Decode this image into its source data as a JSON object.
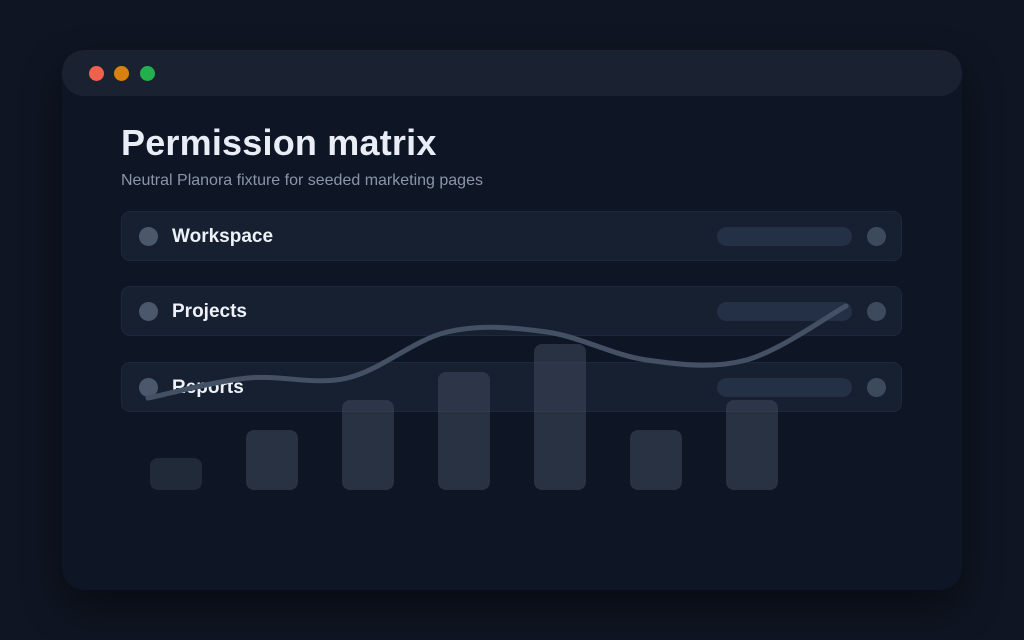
{
  "window": {
    "controls": [
      {
        "name": "close",
        "color": "#f0604d"
      },
      {
        "name": "minimize",
        "color": "#d9800f"
      },
      {
        "name": "maximize",
        "color": "#21b04b"
      }
    ]
  },
  "page": {
    "title": "Permission matrix",
    "subtitle": "Neutral Planora fixture for seeded marketing pages"
  },
  "rows": [
    {
      "label": "Workspace"
    },
    {
      "label": "Projects"
    },
    {
      "label": "Reports"
    }
  ],
  "chart_data": {
    "type": "bar",
    "categories": [
      "",
      "",
      "",
      "",
      "",
      "",
      ""
    ],
    "values": [
      16,
      30,
      45,
      59,
      73,
      30,
      45
    ],
    "ylim": [
      0,
      80
    ],
    "line": {
      "values": [
        46,
        56,
        56,
        79,
        79,
        65,
        65,
        92
      ]
    },
    "grid": false,
    "colors": {
      "bar_light": "#3b4658",
      "bar_dark": "#232c3b",
      "line": "#445064"
    }
  }
}
